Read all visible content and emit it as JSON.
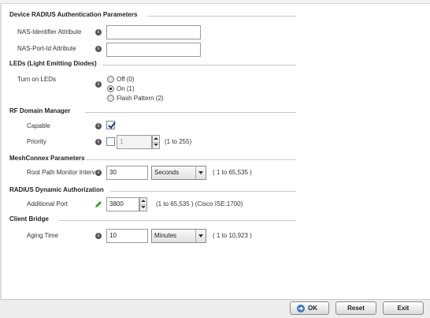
{
  "sections": {
    "device_radius": {
      "title": "Device RADIUS Authentication Parameters",
      "nas_identifier_label": "NAS-Identifier Attribute",
      "nas_identifier_value": "",
      "nas_port_label": "NAS-Port-Id Attribute",
      "nas_port_value": ""
    },
    "leds": {
      "title": "LEDs (Light Emitting Diodes)",
      "turn_on_label": "Turn on LEDs",
      "options": [
        "Off (0)",
        "On (1)",
        "Flash Pattern (2)"
      ],
      "selected": "On (1)"
    },
    "rf_domain": {
      "title": "RF Domain Manager",
      "capable_label": "Capable",
      "capable_checked": true,
      "priority_label": "Priority",
      "priority_checked": false,
      "priority_value": "1",
      "priority_range": "(1 to 255)"
    },
    "meshconnex": {
      "title": "MeshConnex Parameters",
      "root_path_label": "Root Path Monitor Interval",
      "root_path_value": "30",
      "unit": "Seconds",
      "range": "( 1 to 65,535 )"
    },
    "radius_dynamic": {
      "title": "RADIUS Dynamic Authorization",
      "port_label": "Additional Port",
      "port_value": "3800",
      "range": "(1 to 65,535 )  (Cisco ISE:1700)"
    },
    "client_bridge": {
      "title": "Client Bridge",
      "aging_label": "Aging Time",
      "aging_value": "10",
      "unit": "Minutes",
      "range": "( 1 to 10,923 )"
    }
  },
  "footer": {
    "ok_label": "OK",
    "reset_label": "Reset",
    "exit_label": "Exit"
  },
  "colors": {
    "ok_icon": "#3b78c4",
    "pencil": "#3a9a2a"
  }
}
